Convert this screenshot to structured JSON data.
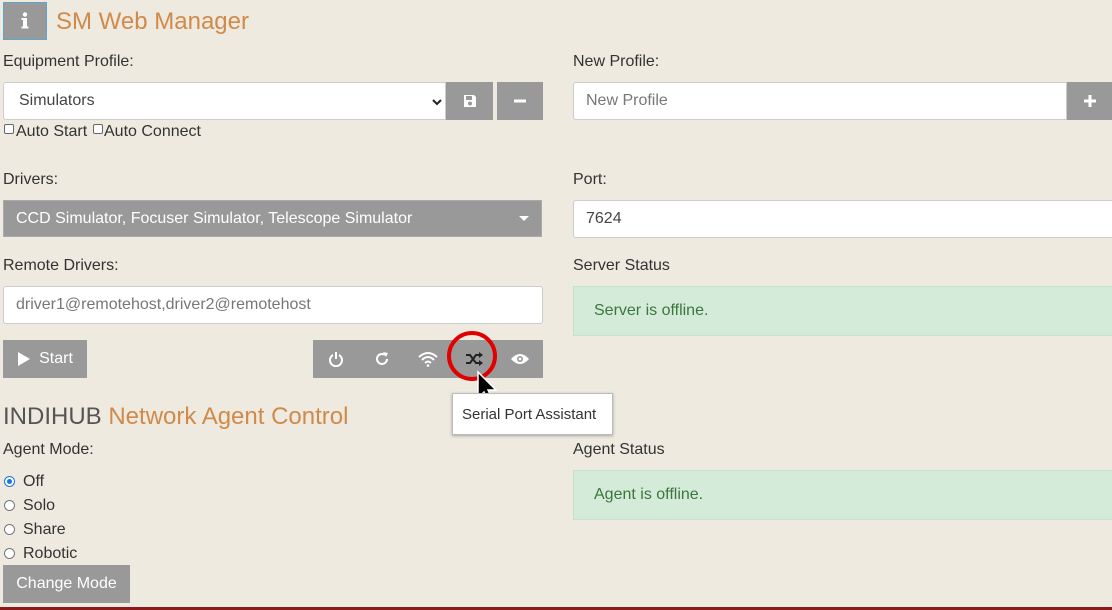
{
  "header": {
    "info_icon": "info-icon",
    "title": "SM Web Manager"
  },
  "profile": {
    "label": "Equipment Profile:",
    "selected": "Simulators",
    "save_icon": "save-icon",
    "remove_icon": "minus-icon",
    "auto_start": "Auto Start",
    "auto_connect": "Auto Connect"
  },
  "new_profile": {
    "label": "New Profile:",
    "placeholder": "New Profile",
    "add_icon": "plus-icon"
  },
  "drivers": {
    "label": "Drivers:",
    "selected": "CCD Simulator, Focuser Simulator, Telescope Simulator"
  },
  "port": {
    "label": "Port:",
    "value": "7624"
  },
  "remote_drivers": {
    "label": "Remote Drivers:",
    "placeholder": "driver1@remotehost,driver2@remotehost"
  },
  "server_status": {
    "label": "Server Status",
    "text": "Server is offline."
  },
  "controls": {
    "start_label": "Start",
    "tools": [
      "power-icon",
      "refresh-icon",
      "wifi-icon",
      "shuffle-icon",
      "eye-icon"
    ],
    "tooltip": "Serial Port Assistant"
  },
  "agent": {
    "title_part1": "INDIHUB",
    "title_part2": " Network Agent Control",
    "mode_label": "Agent Mode:",
    "modes": [
      "Off",
      "Solo",
      "Share",
      "Robotic"
    ],
    "selected_mode": "Off",
    "change_label": "Change Mode",
    "status_label": "Agent Status",
    "status_text": "Agent is offline."
  },
  "colors": {
    "accent": "#d08a4a",
    "button": "#999999",
    "background": "#eeeae0",
    "status_bg": "#d4ebd9",
    "status_text": "#3c763d",
    "highlight": "#e00000"
  }
}
